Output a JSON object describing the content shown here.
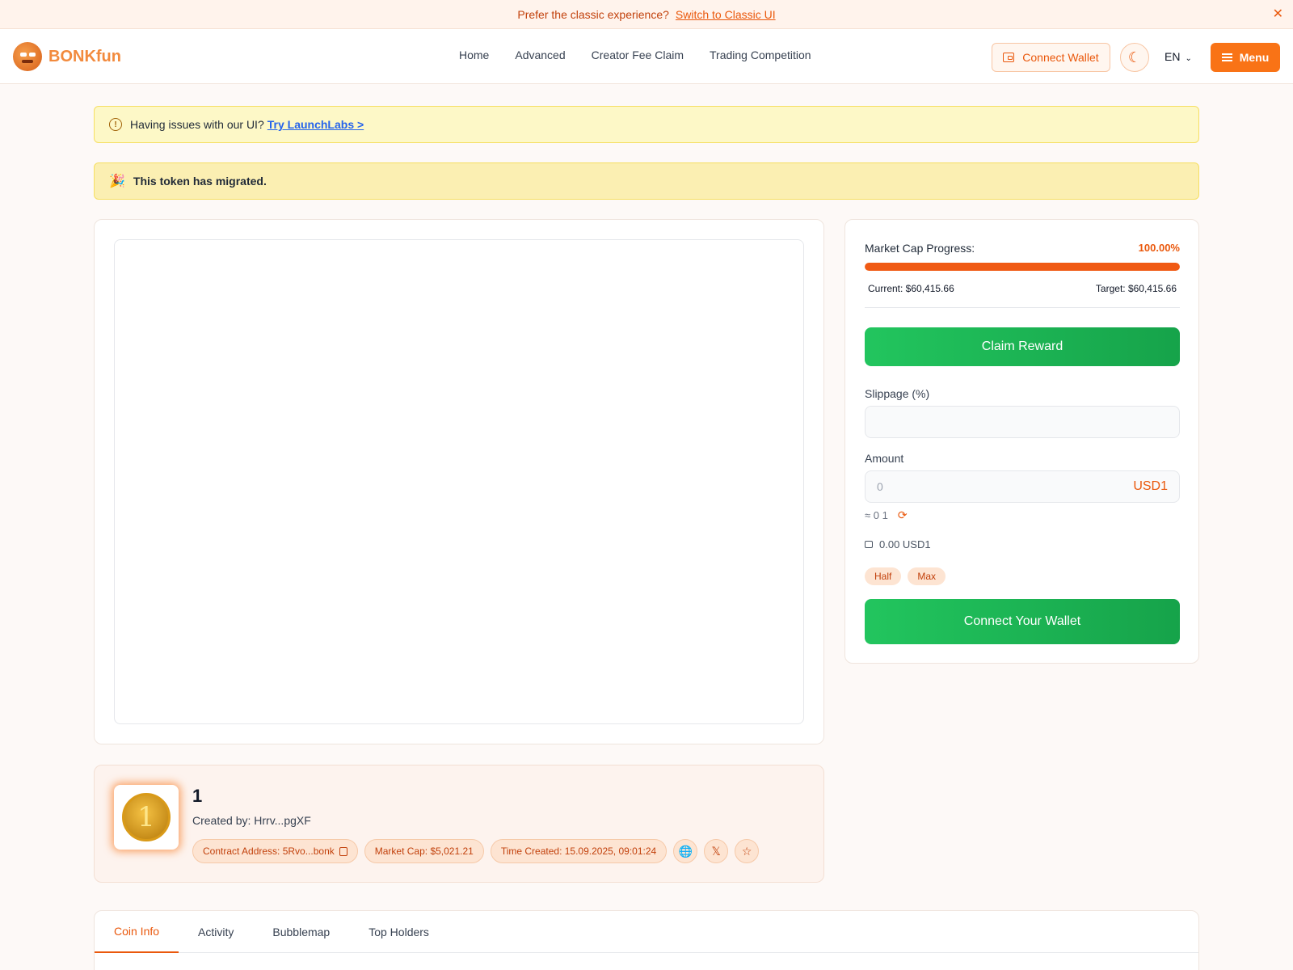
{
  "banner": {
    "text": "Prefer the classic experience?",
    "link": "Switch to Classic UI",
    "close": "✕"
  },
  "header": {
    "brand": "BONKfun",
    "nav": [
      "Home",
      "Advanced",
      "Creator Fee Claim",
      "Trading Competition"
    ],
    "connect_label": "Connect Wallet",
    "lang": "EN",
    "menu_label": "Menu",
    "accent_color": "#f97316"
  },
  "alerts": {
    "issue_text": "Having issues with our UI?",
    "issue_link": "Try LaunchLabs >",
    "migrated_text": "This token has migrated."
  },
  "trade": {
    "progress_label": "Market Cap Progress:",
    "progress_value": "100.00%",
    "progress_fraction": 1.0,
    "current": "Current: $60,415.66",
    "target": "Target: $60,415.66",
    "claim_label": "Claim Reward",
    "slippage_label": "Slippage (%)",
    "slippage_value": "",
    "amount_label": "Amount",
    "amount_placeholder": "0",
    "amount_currency": "USD1",
    "approx": "≈ 0 1",
    "balance": "0.00 USD1",
    "half_label": "Half",
    "max_label": "Max",
    "connect_label": "Connect Your Wallet",
    "button_color": "#22c55e"
  },
  "token": {
    "name": "1",
    "coin_glyph": "1",
    "creator": "Created by: Hrrv...pgXF",
    "contract": "Contract Address: 5Rvo...bonk",
    "market_cap": "Market Cap: $5,021.21",
    "created": "Time Created: 15.09.2025, 09:01:24"
  },
  "tabs": [
    "Coin Info",
    "Activity",
    "Bubblemap",
    "Top Holders"
  ]
}
